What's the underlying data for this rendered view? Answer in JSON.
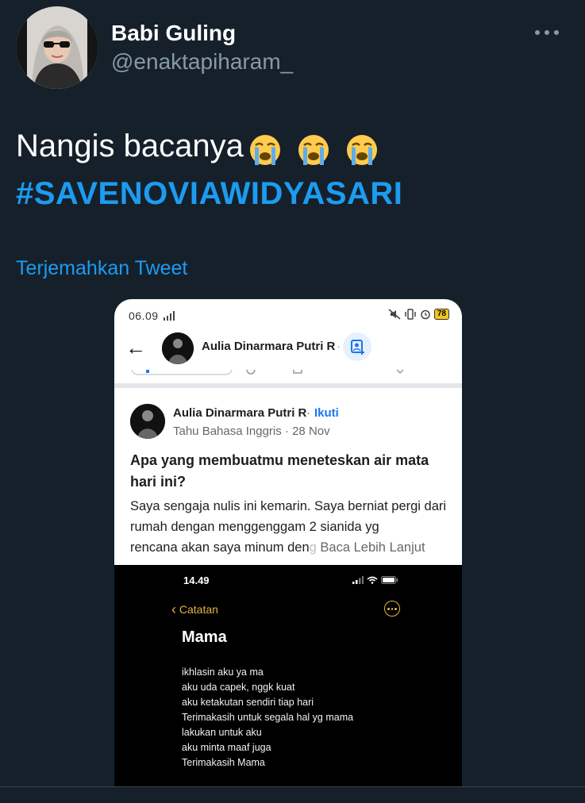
{
  "tweet": {
    "author_name": "Babi Guling",
    "author_handle": "@enaktapiharam_",
    "text": "Nangis bacanya",
    "emoji_icons": [
      "loudly-crying-face",
      "loudly-crying-face",
      "loudly-crying-face"
    ],
    "hashtag": "#SAVENOVIAWIDYASARI",
    "translate_label": "Terjemahkan Tweet"
  },
  "screenshot": {
    "status_time": "06.09",
    "battery": "78",
    "header_name": "Aulia Dinarmara Putri R",
    "header_separator": "·",
    "post": {
      "author": "Aulia Dinarmara Putri R",
      "separator": "·",
      "follow_label": "Ikuti",
      "subtitle": "Tahu Bahasa Inggris · 28 Nov",
      "question": "Apa yang membuatmu meneteskan air mata hari ini?",
      "body": "Saya sengaja nulis ini kemarin. Saya berniat pergi dari rumah dengan menggenggam 2 sianida yg",
      "last_line": "rencana akan saya minum den",
      "last_line_fade": "g",
      "read_more": "Baca Lebih Lanjut"
    },
    "notes": {
      "status_time": "14.49",
      "back_label": "Catatan",
      "title": "Mama",
      "lines": [
        "ikhlasin aku ya ma",
        "aku uda capek, nggk kuat",
        "aku ketakutan sendiri tiap hari",
        "Terimakasih untuk segala hal yg mama",
        "lakukan untuk aku",
        "aku minta maaf juga",
        "Terimakasih Mama"
      ]
    }
  },
  "colors": {
    "background": "#15202b",
    "link": "#1d9bf0",
    "secondary_text": "#8899a6",
    "notes_accent": "#e3b341",
    "facebook_blue": "#1877f2"
  }
}
